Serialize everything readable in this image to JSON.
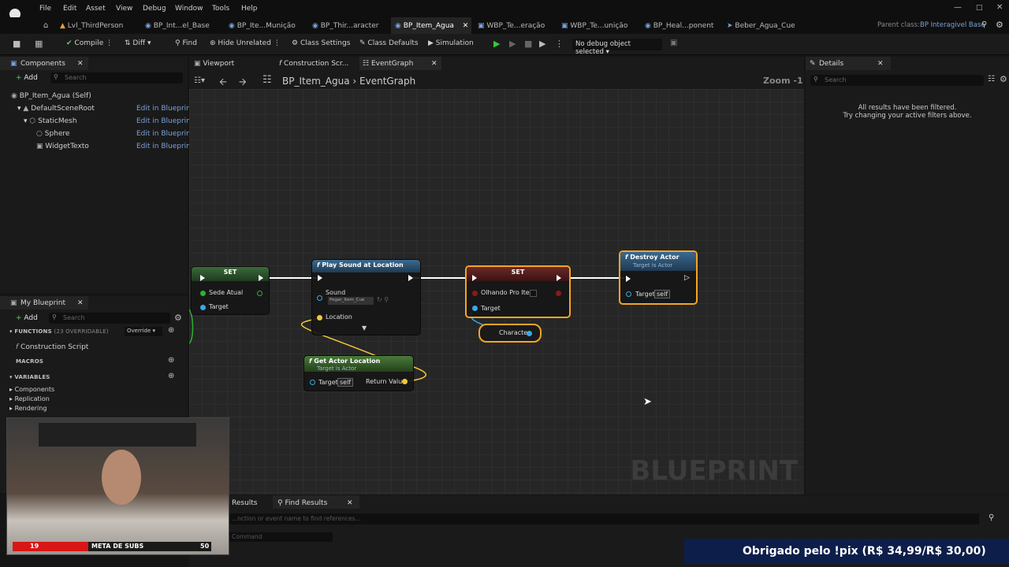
{
  "menu": [
    "File",
    "Edit",
    "Asset",
    "View",
    "Debug",
    "Window",
    "Tools",
    "Help"
  ],
  "tabs": [
    {
      "label": "Lvl_ThirdPerson"
    },
    {
      "label": "BP_Int...el_Base"
    },
    {
      "label": "BP_Ite...Munição"
    },
    {
      "label": "BP_Thir...aracter"
    },
    {
      "label": "BP_Item_Agua"
    },
    {
      "label": "WBP_Te...eração"
    },
    {
      "label": "WBP_Te...unição"
    },
    {
      "label": "BP_Heal...ponent"
    },
    {
      "label": "Beber_Agua_Cue"
    }
  ],
  "parent_class_label": "Parent class:",
  "parent_class_value": "BP Interagivel Base",
  "toolbar": {
    "compile": "Compile",
    "diff": "Diff",
    "find": "Find",
    "hide_unrelated": "Hide Unrelated",
    "class_settings": "Class Settings",
    "class_defaults": "Class Defaults",
    "simulation": "Simulation",
    "debug_object": "No debug object selected"
  },
  "components": {
    "tab": "Components",
    "add": "Add",
    "search_placeholder": "Search",
    "items": [
      {
        "label": "BP_Item_Agua (Self)",
        "edit": ""
      },
      {
        "label": "DefaultSceneRoot",
        "edit": "Edit in Blueprint"
      },
      {
        "label": "StaticMesh",
        "edit": "Edit in Blueprint"
      },
      {
        "label": "Sphere",
        "edit": "Edit in Blueprint"
      },
      {
        "label": "WidgetTexto",
        "edit": "Edit in Blueprint"
      }
    ]
  },
  "my_blueprint": {
    "tab": "My Blueprint",
    "add": "Add",
    "search_placeholder": "Search",
    "functions": "FUNCTIONS",
    "functions_count": "(23 OVERRIDABLE)",
    "override": "Override",
    "construction_script": "Construction Script",
    "macros": "MACROS",
    "variables": "VARIABLES",
    "var_categories": [
      "Components",
      "Replication",
      "Rendering"
    ]
  },
  "editor_tabs": {
    "viewport": "Viewport",
    "construction": "Construction Scr...",
    "event_graph": "EventGraph"
  },
  "breadcrumb": {
    "blueprint": "BP_Item_Agua",
    "graph": "EventGraph"
  },
  "zoom": "Zoom -1",
  "nodes": {
    "set1": {
      "title": "SET",
      "pin1": "Sede Atual",
      "pin2": "Target"
    },
    "play_sound": {
      "title": "Play Sound at Location",
      "sound": "Sound",
      "sound_value": "Pegar_Item_Cue",
      "location": "Location"
    },
    "set2": {
      "title": "SET",
      "pin1": "Olhando Pro Item",
      "pin2": "Target"
    },
    "destroy": {
      "title": "Destroy Actor",
      "subtitle": "Target is Actor",
      "target": "Target",
      "self": "self"
    },
    "character": {
      "title": "Character"
    },
    "get_loc": {
      "title": "Get Actor Location",
      "subtitle": "Target is Actor",
      "target": "Target",
      "self": "self",
      "ret": "Return Value"
    }
  },
  "watermark": "BLUEPRINT",
  "details": {
    "tab": "Details",
    "search_placeholder": "Search",
    "msg1": "All results have been filtered.",
    "msg2": "Try changing your active filters above."
  },
  "bottom": {
    "results_tab": "Results",
    "find_results_tab": "Find Results",
    "find_placeholder": "...nction or event name to find references...",
    "command_placeholder": "Command"
  },
  "stream": {
    "subs_current": "19",
    "subs_label": "META DE SUBS",
    "subs_goal": "50",
    "subs_progress": 0.38,
    "donation": "Obrigado pelo !pix (R$ 34,99/R$ 30,00)"
  }
}
